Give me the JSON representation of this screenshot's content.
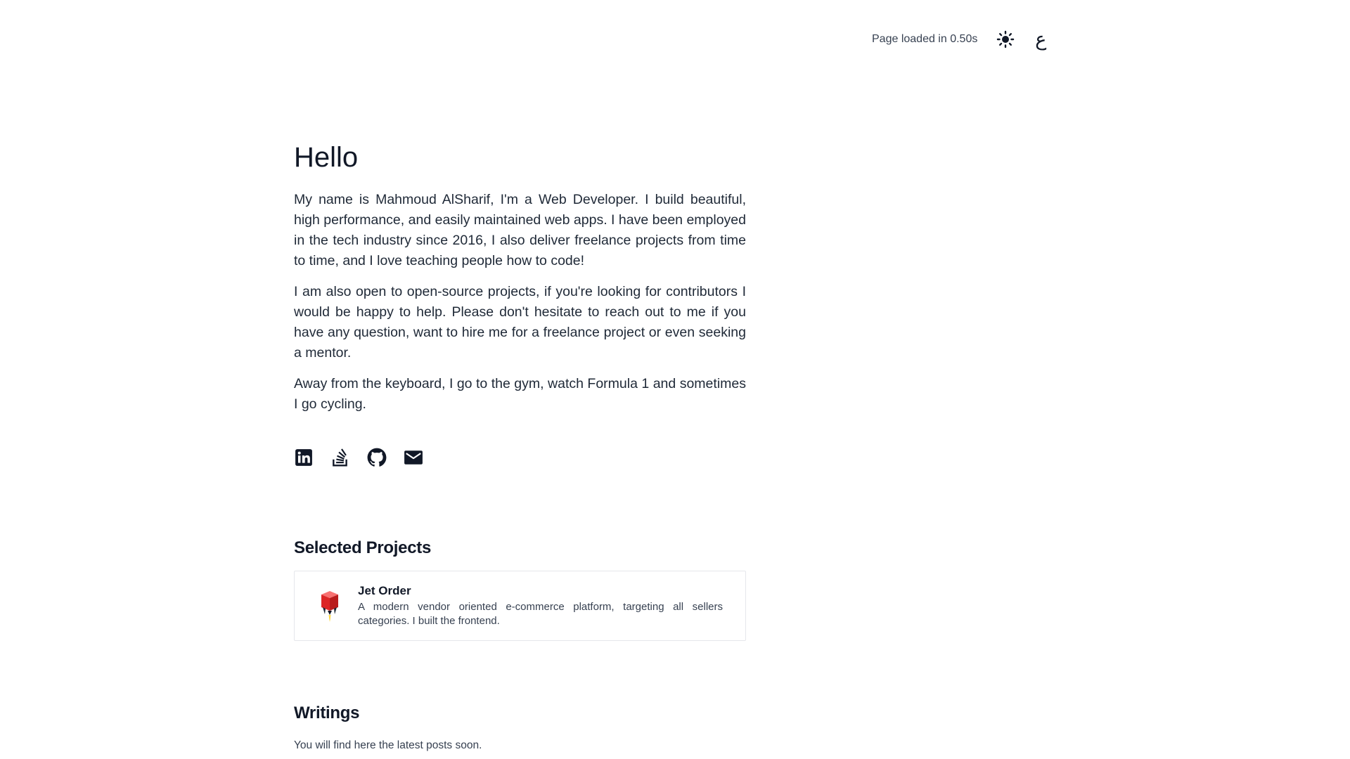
{
  "topbar": {
    "load_text": "Page loaded in 0.50s",
    "theme_icon": "sun-icon",
    "language_label": "ع"
  },
  "intro": {
    "title": "Hello",
    "paragraphs": [
      "My name is Mahmoud AlSharif, I'm a Web Developer. I build beautiful, high performance, and easily maintained web apps. I have been employed in the tech industry since 2016, I also deliver freelance projects from time to time, and I love teaching people how to code!",
      "I am also open to open-source projects, if you're looking for contributors I would be happy to help. Please don't hesitate to reach out to me if you have any question, want to hire me for a freelance project or even seeking a mentor.",
      "Away from the keyboard, I go to the gym, watch Formula 1 and sometimes I go cycling."
    ]
  },
  "socials": [
    {
      "icon": "linkedin-icon"
    },
    {
      "icon": "stackoverflow-icon"
    },
    {
      "icon": "github-icon"
    },
    {
      "icon": "email-icon"
    }
  ],
  "projects": {
    "heading": "Selected Projects",
    "items": [
      {
        "title": "Jet Order",
        "description": "A modern vendor oriented e-commerce platform, targeting all sellers categories. I built the frontend.",
        "logo_icon": "jet-order-logo",
        "logo_color": "#e11d2e"
      }
    ]
  },
  "writings": {
    "heading": "Writings",
    "text": "You will find here the latest posts soon."
  }
}
